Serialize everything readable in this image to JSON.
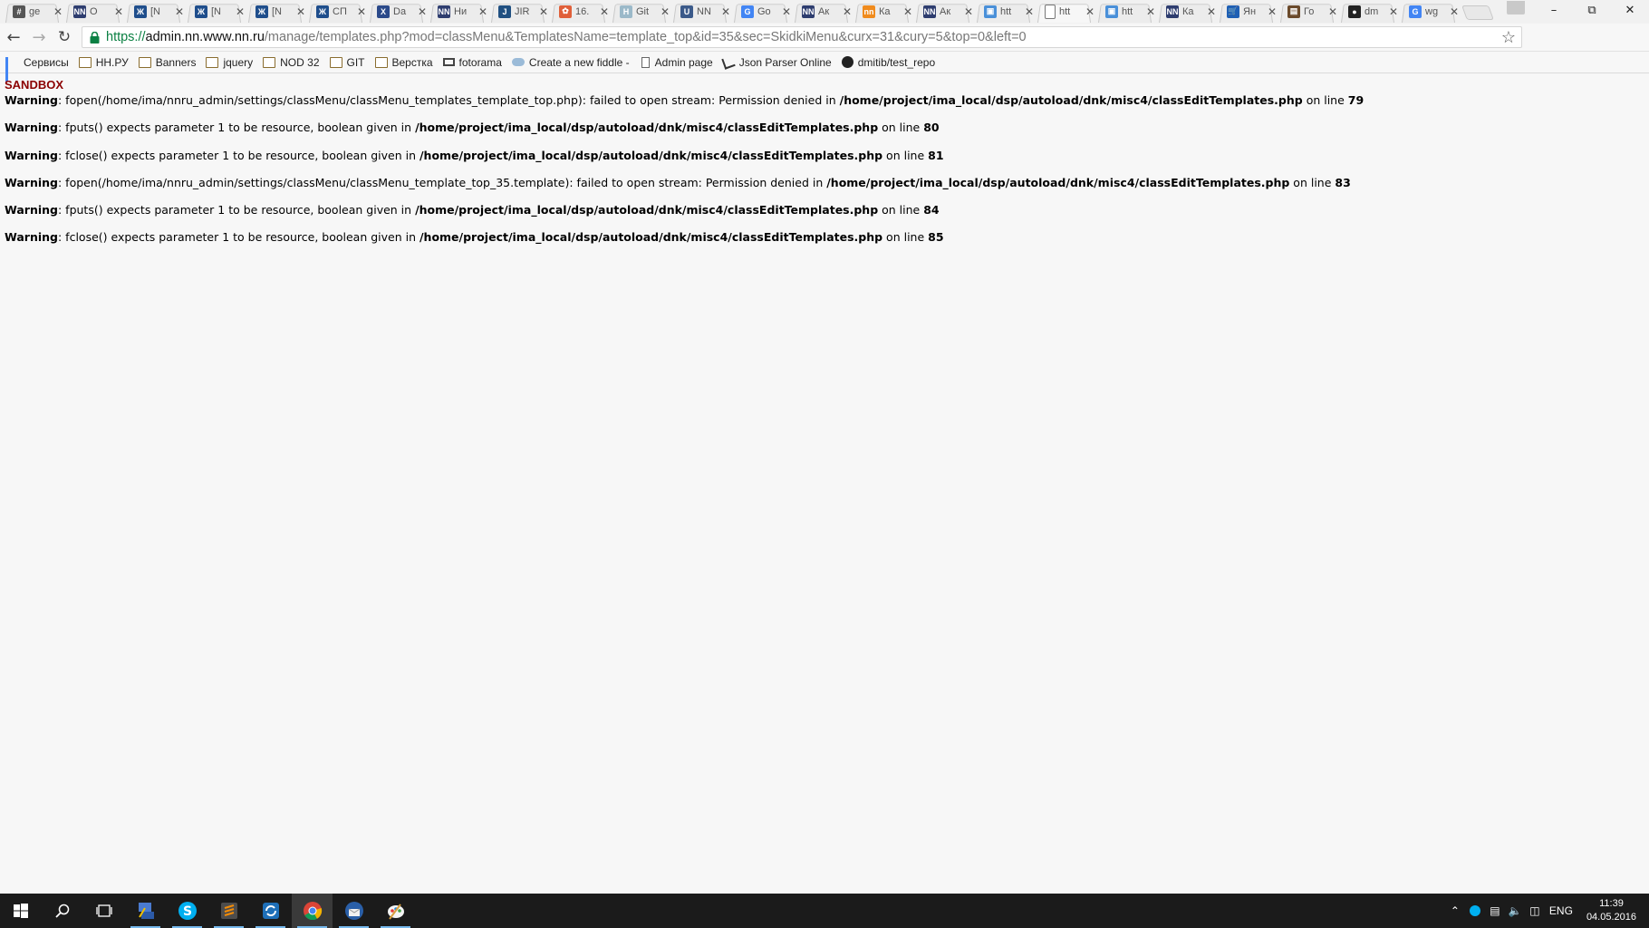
{
  "tabs": [
    {
      "label": "ge",
      "icon": "hash-icon",
      "color": "#555555",
      "glyph": "#"
    },
    {
      "label": "O",
      "icon": "nn-icon",
      "color": "#2e3d6f",
      "glyph": "NN"
    },
    {
      "label": "[N",
      "icon": "nn-admin-icon",
      "color": "#1f4e8c",
      "glyph": "Ж"
    },
    {
      "label": "[N",
      "icon": "nn-admin-icon",
      "color": "#1f4e8c",
      "glyph": "Ж"
    },
    {
      "label": "[N",
      "icon": "nn-admin-icon",
      "color": "#1f4e8c",
      "glyph": "Ж"
    },
    {
      "label": "СП",
      "icon": "nn-admin-icon",
      "color": "#1f4e8c",
      "glyph": "Ж"
    },
    {
      "label": "Da",
      "icon": "x-icon",
      "color": "#2b4a8a",
      "glyph": "X"
    },
    {
      "label": "Ни",
      "icon": "nn-icon",
      "color": "#2e3d6f",
      "glyph": "NN"
    },
    {
      "label": "JIR",
      "icon": "jira-icon",
      "color": "#205081",
      "glyph": "J"
    },
    {
      "label": "16.",
      "icon": "bird-icon",
      "color": "#e0603a",
      "glyph": "✿"
    },
    {
      "label": "Git",
      "icon": "gitlab-icon",
      "color": "#9bb9c9",
      "glyph": "H"
    },
    {
      "label": "NN",
      "icon": "shield-icon",
      "color": "#3b5a8a",
      "glyph": "U"
    },
    {
      "label": "Go",
      "icon": "google-translate-icon",
      "color": "#4285f4",
      "glyph": "G"
    },
    {
      "label": "Ак",
      "icon": "nn-icon",
      "color": "#2e3d6f",
      "glyph": "NN"
    },
    {
      "label": "Ка",
      "icon": "orange-circle-icon",
      "color": "#f08b1d",
      "glyph": "nn"
    },
    {
      "label": "Ак",
      "icon": "nn-icon",
      "color": "#2e3d6f",
      "glyph": "NN"
    },
    {
      "label": "htt",
      "icon": "image-icon",
      "color": "#4a90d9",
      "glyph": "▣"
    },
    {
      "label": "htt",
      "icon": "page-icon",
      "color": "#ffffff",
      "glyph": ""
    },
    {
      "label": "htt",
      "icon": "image-icon",
      "color": "#4a90d9",
      "glyph": "▣"
    },
    {
      "label": "Ка",
      "icon": "nn-icon",
      "color": "#2e3d6f",
      "glyph": "NN"
    },
    {
      "label": "Ян",
      "icon": "cart-icon",
      "color": "#1e5fb4",
      "glyph": "🛒"
    },
    {
      "label": "Го",
      "icon": "book-icon",
      "color": "#6b4a2b",
      "glyph": "▤"
    },
    {
      "label": "dm",
      "icon": "github-icon",
      "color": "#222222",
      "glyph": "●"
    },
    {
      "label": "wg",
      "icon": "google-icon",
      "color": "#4285f4",
      "glyph": "G"
    }
  ],
  "active_tab_index": 17,
  "address": {
    "scheme": "https://",
    "host": "admin.nn.www.nn.ru",
    "path": "/manage/templates.php?mod=classMenu&TemplatesName=template_top&id=35&sec=SkidkiMenu&curx=31&cury=5&top=0&left=0"
  },
  "bookmarks": [
    {
      "label": "Сервисы",
      "icon": "apps-icon"
    },
    {
      "label": "НН.РУ",
      "icon": "folder-icon"
    },
    {
      "label": "Banners",
      "icon": "folder-icon"
    },
    {
      "label": "jquery",
      "icon": "folder-icon"
    },
    {
      "label": "NOD 32",
      "icon": "folder-icon"
    },
    {
      "label": "GIT",
      "icon": "folder-icon"
    },
    {
      "label": "Верстка",
      "icon": "folder-icon"
    },
    {
      "label": "fotorama",
      "icon": "monitor-icon"
    },
    {
      "label": "Create a new fiddle -",
      "icon": "cloud-icon"
    },
    {
      "label": "Admin page",
      "icon": "page-icon"
    },
    {
      "label": "Json Parser Online",
      "icon": "json-icon"
    },
    {
      "label": "dmitib/test_repo",
      "icon": "github-icon"
    }
  ],
  "content": {
    "sandbox": "SANDBOX",
    "warnings": [
      {
        "label": "Warning",
        "text": ": fopen(/home/ima/nnru_admin/settings/classMenu/classMenu_templates_template_top.php): failed to open stream: Permission denied in ",
        "file": "/home/project/ima_local/dsp/autoload/dnk/misc4/classEditTemplates.php",
        "on_line": " on line ",
        "line": "79"
      },
      {
        "label": "Warning",
        "text": ": fputs() expects parameter 1 to be resource, boolean given in ",
        "file": "/home/project/ima_local/dsp/autoload/dnk/misc4/classEditTemplates.php",
        "on_line": " on line ",
        "line": "80"
      },
      {
        "label": "Warning",
        "text": ": fclose() expects parameter 1 to be resource, boolean given in ",
        "file": "/home/project/ima_local/dsp/autoload/dnk/misc4/classEditTemplates.php",
        "on_line": " on line ",
        "line": "81"
      },
      {
        "label": "Warning",
        "text": ": fopen(/home/ima/nnru_admin/settings/classMenu/classMenu_template_top_35.template): failed to open stream: Permission denied in ",
        "file": "/home/project/ima_local/dsp/autoload/dnk/misc4/classEditTemplates.php",
        "on_line": " on line ",
        "line": "83"
      },
      {
        "label": "Warning",
        "text": ": fputs() expects parameter 1 to be resource, boolean given in ",
        "file": "/home/project/ima_local/dsp/autoload/dnk/misc4/classEditTemplates.php",
        "on_line": " on line ",
        "line": "84"
      },
      {
        "label": "Warning",
        "text": ": fclose() expects parameter 1 to be resource, boolean given in ",
        "file": "/home/project/ima_local/dsp/autoload/dnk/misc4/classEditTemplates.php",
        "on_line": " on line ",
        "line": "85"
      }
    ]
  },
  "taskbar": {
    "apps": [
      {
        "icon": "start-icon",
        "open": false,
        "active": false
      },
      {
        "icon": "search-icon",
        "open": false,
        "active": false
      },
      {
        "icon": "task-view-icon",
        "open": false,
        "active": false
      },
      {
        "icon": "network-app-icon",
        "open": true,
        "active": false
      },
      {
        "icon": "skype-icon",
        "open": true,
        "active": false
      },
      {
        "icon": "sublime-icon",
        "open": true,
        "active": false
      },
      {
        "icon": "sync-icon",
        "open": true,
        "active": false
      },
      {
        "icon": "chrome-icon",
        "open": true,
        "active": true
      },
      {
        "icon": "thunderbird-icon",
        "open": true,
        "active": false
      },
      {
        "icon": "paint-icon",
        "open": true,
        "active": false
      }
    ],
    "language": "ENG",
    "time": "11:39",
    "date": "04.05.2016"
  },
  "colors": {
    "sandbox": "#8b0000",
    "scheme": "#0b8043",
    "taskbar": "#1b1b1b",
    "taskbar_accent": "#76b9ed"
  }
}
